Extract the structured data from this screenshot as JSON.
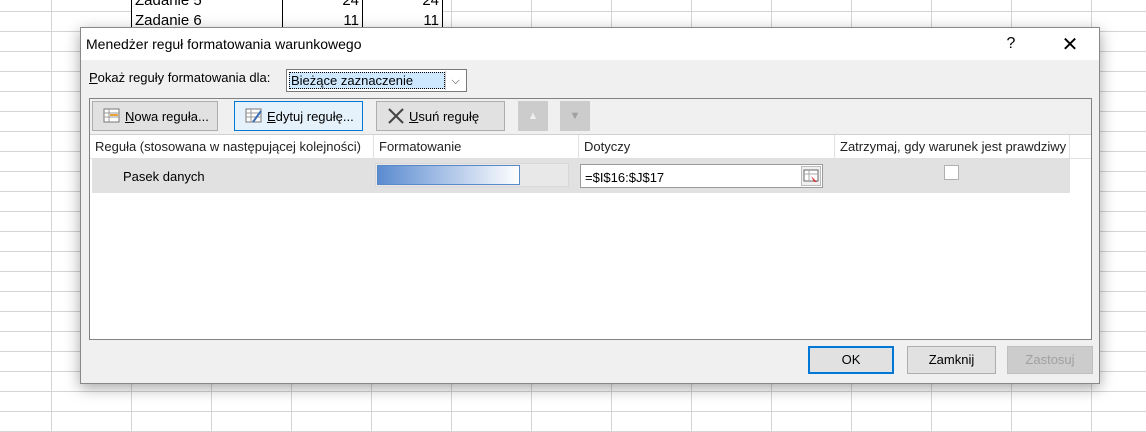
{
  "sheet": {
    "rows": [
      {
        "label": "Zadanie 5",
        "v1": "24",
        "v2": "24"
      },
      {
        "label": "Zadanie 6",
        "v1": "11",
        "v2": "11"
      }
    ]
  },
  "dialog": {
    "title": "Menedżer reguł formatowania warunkowego",
    "help": "?",
    "close": "✕",
    "show_rules_label_accel": "P",
    "show_rules_label_rest": "okaż reguły formatowania dla:",
    "show_rules_value": "Bieżące zaznaczenie",
    "dropdown_arrow": "⌵",
    "toolbar": {
      "new_rule_accel": "N",
      "new_rule_rest": "owa reguła...",
      "edit_rule_accel": "E",
      "edit_rule_rest": "dytuj regułę...",
      "delete_rule_accel": "U",
      "delete_rule_rest": "suń regułę",
      "up_arrow": "▲",
      "down_arrow": "▼"
    },
    "columns": {
      "rule": "Reguła (stosowana w następującej kolejności)",
      "format": "Formatowanie",
      "applies_to": "Dotyczy",
      "stop_if_true": "Zatrzymaj, gdy warunek jest prawdziwy"
    },
    "rules": [
      {
        "name": "Pasek danych",
        "applies_to": "=$I$16:$J$17",
        "stop_if_true": false
      }
    ],
    "buttons": {
      "ok": "OK",
      "close": "Zamknij",
      "apply": "Zastosuj"
    },
    "colors": {
      "accent": "#0078d7",
      "databar_start": "#5b8bd0",
      "databar_end": "#ffffff"
    }
  }
}
